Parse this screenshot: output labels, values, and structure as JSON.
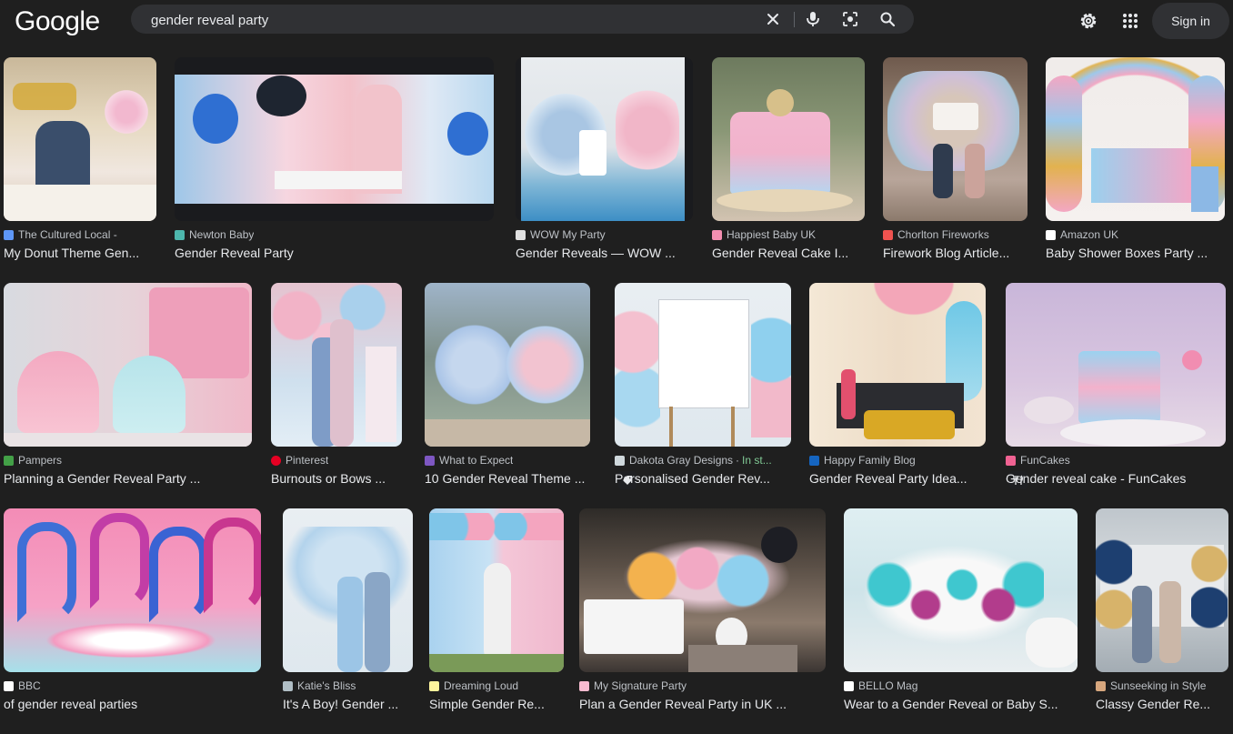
{
  "header": {
    "logo": "Google",
    "query": "gender reveal party",
    "signin_label": "Sign in"
  },
  "results": [
    {
      "source": "The Cultured Local -",
      "title": "My Donut Theme Gen...",
      "fav": "#5e97f6"
    },
    {
      "source": "Newton Baby",
      "title": "Gender Reveal Party",
      "fav": "#4db6ac"
    },
    {
      "source": "WOW My Party",
      "title": "Gender Reveals — WOW ...",
      "fav": "#e0e0e0"
    },
    {
      "source": "Happiest Baby UK",
      "title": "Gender Reveal Cake I...",
      "fav": "#f48fb1"
    },
    {
      "source": "Chorlton Fireworks",
      "title": "Firework Blog Article...",
      "fav": "#ef5350"
    },
    {
      "source": "Amazon UK",
      "title": "Baby Shower Boxes Party ...",
      "fav": "#ffffff"
    },
    {
      "source": "Pampers",
      "title": "Planning a Gender Reveal Party ...",
      "fav": "#43a047"
    },
    {
      "source": "Pinterest",
      "title": "Burnouts or Bows ...",
      "fav": "#e60023"
    },
    {
      "source": "What to Expect",
      "title": "10 Gender Reveal Theme ...",
      "fav": "#7e57c2"
    },
    {
      "source": "Dakota Gray Designs",
      "stock": "In st...",
      "title": "Personalised Gender Rev...",
      "fav": "#cfd8dc"
    },
    {
      "source": "Happy Family Blog",
      "title": "Gender Reveal Party Idea...",
      "fav": "#1565c0"
    },
    {
      "source": "FunCakes",
      "title": "Gender reveal cake - FunCakes",
      "fav": "#f06292"
    },
    {
      "source": "BBC",
      "title": "of gender reveal parties",
      "fav": "#ffffff"
    },
    {
      "source": "Katie's Bliss",
      "title": "It's A Boy! Gender ...",
      "fav": "#b0bec5"
    },
    {
      "source": "Dreaming Loud",
      "title": "Simple Gender Re...",
      "fav": "#fff59d"
    },
    {
      "source": "My Signature Party",
      "title": "Plan a Gender Reveal Party in UK ...",
      "fav": "#f8bbd0"
    },
    {
      "source": "BELLO Mag",
      "title": "Wear to a Gender Reveal or Baby S...",
      "fav": "#ffffff"
    },
    {
      "source": "Sunseeking in Style",
      "title": "Classy Gender Re...",
      "fav": "#d7a77e"
    }
  ]
}
